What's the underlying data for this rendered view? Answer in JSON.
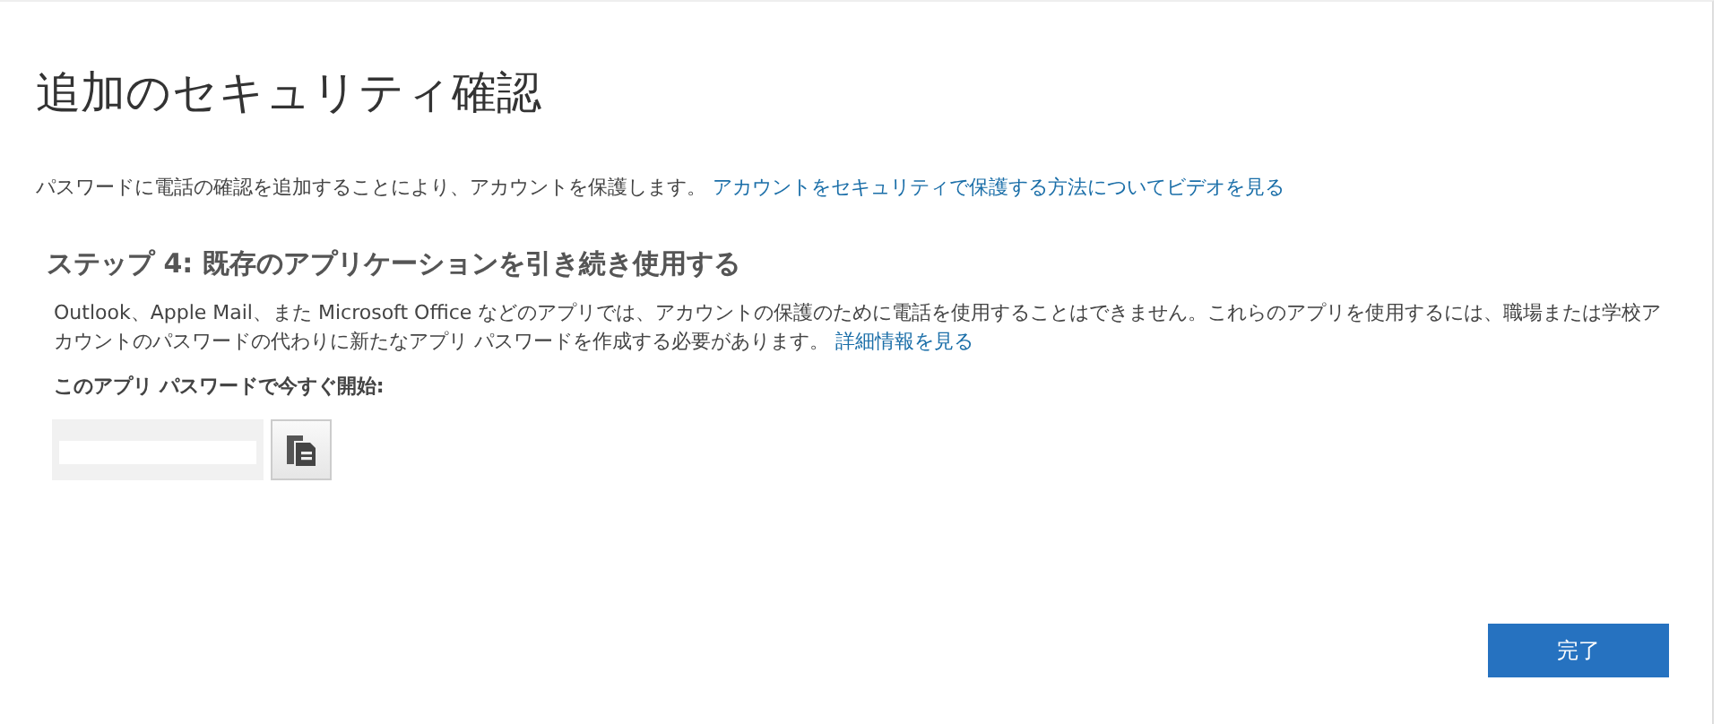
{
  "title": "追加のセキュリティ確認",
  "intro": {
    "text": "パスワードに電話の確認を追加することにより、アカウントを保護します。",
    "link": "アカウントをセキュリティで保護する方法についてビデオを見る"
  },
  "step": {
    "heading": "ステップ 4: 既存のアプリケーションを引き続き使用する",
    "text": "Outlook、Apple Mail、また Microsoft Office などのアプリでは、アカウントの保護のために電話を使用することはできません。これらのアプリを使用するには、職場または学校アカウントのパスワードの代わりに新たなアプリ パスワードを作成する必要があります。",
    "link": "詳細情報を見る",
    "label": "このアプリ パスワードで今すぐ開始:"
  },
  "done_button": "完了"
}
